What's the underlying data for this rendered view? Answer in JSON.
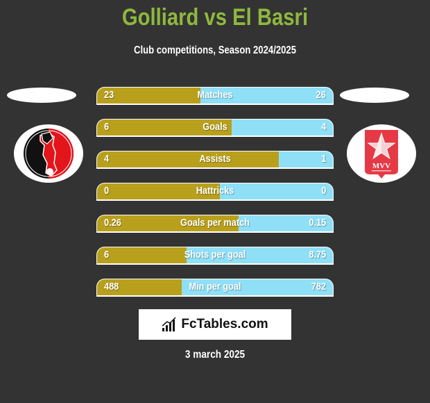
{
  "header": {
    "title": "Golliard vs El Basri",
    "subtitle": "Club competitions, Season 2024/2025"
  },
  "teams": {
    "left": {
      "logo": "helmond-sport-crest-icon"
    },
    "right": {
      "logo": "mvv-maastricht-crest-icon",
      "logo_text": "MVV"
    }
  },
  "colors": {
    "title": "#8fb83e",
    "left_bar": "#b8a01c",
    "right_bar": "#8fe0f7",
    "background": "#333333"
  },
  "stats": [
    {
      "label": "Matches",
      "left": "23",
      "right": "26",
      "left_share": 0.44
    },
    {
      "label": "Goals",
      "left": "6",
      "right": "4",
      "left_share": 0.57
    },
    {
      "label": "Assists",
      "left": "4",
      "right": "1",
      "left_share": 0.77
    },
    {
      "label": "Hattricks",
      "left": "0",
      "right": "0",
      "left_share": 0.52
    },
    {
      "label": "Goals per match",
      "left": "0.26",
      "right": "0.15",
      "left_share": 0.6
    },
    {
      "label": "Shots per goal",
      "left": "6",
      "right": "8.75",
      "left_share": 0.38
    },
    {
      "label": "Min per goal",
      "left": "488",
      "right": "782",
      "left_share": 0.36
    }
  ],
  "brand": {
    "name": "FcTables.com",
    "icon": "bar-chart-icon"
  },
  "date": "3 march 2025"
}
